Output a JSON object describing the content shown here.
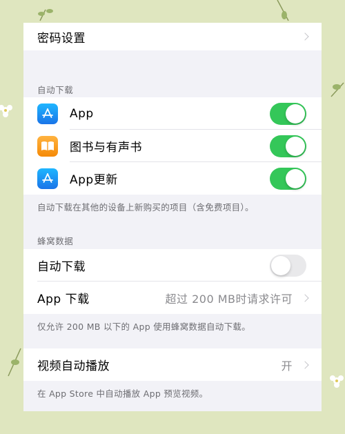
{
  "passcode": {
    "label": "密码设置"
  },
  "auto_downloads": {
    "header": "自动下载",
    "items": [
      {
        "label": "App",
        "icon": "app-store-icon",
        "enabled": true
      },
      {
        "label": "图书与有声书",
        "icon": "books-icon",
        "enabled": true
      },
      {
        "label": "App更新",
        "icon": "app-store-icon",
        "enabled": true
      }
    ],
    "footer": "自动下载在其他的设备上新购买的项目（含免费项目）。"
  },
  "cellular": {
    "header": "蜂窝数据",
    "auto_download": {
      "label": "自动下载",
      "enabled": false
    },
    "app_downloads": {
      "label": "App 下载",
      "value": "超过 200 MB时请求许可"
    },
    "footer": "仅允许 200 MB 以下的 App 使用蜂窝数据自动下载。"
  },
  "video": {
    "label": "视频自动播放",
    "value": "开",
    "footer": "在 App Store 中自动播放 App 预览视频。"
  },
  "colors": {
    "toggle_on": "#34c759",
    "toggle_off": "#e9e9eb",
    "background": "#dfe6bf",
    "app_icon_blue": "#1a8cf0",
    "books_icon_orange": "#f79a1e"
  }
}
